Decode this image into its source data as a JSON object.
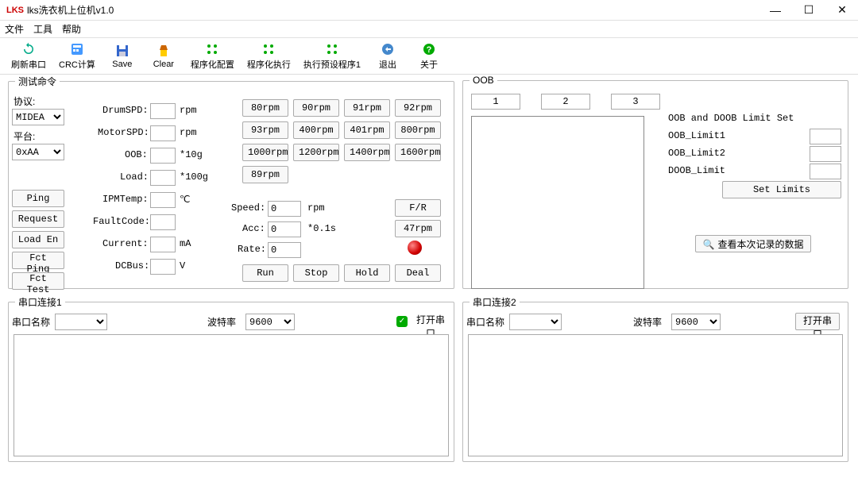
{
  "window": {
    "logo": "LKS",
    "title": "lks洗衣机上位机v1.0"
  },
  "menu": {
    "file": "文件",
    "tools": "工具",
    "help": "帮助"
  },
  "toolbar": {
    "refresh": "刷新串口",
    "crc": "CRC计算",
    "save": "Save",
    "clear": "Clear",
    "cfg": "程序化配置",
    "run": "程序化执行",
    "preset": "执行预设程序1",
    "exit": "退出",
    "about": "关于"
  },
  "groups": {
    "test": "测试命令",
    "oob": "OOB",
    "serial1": "串口连接1",
    "serial2": "串口连接2"
  },
  "test": {
    "protocol_lbl": "协议:",
    "protocol_val": "MIDEA",
    "platform_lbl": "平台:",
    "platform_val": "0xAA",
    "btn_ping": "Ping",
    "btn_request": "Request",
    "btn_loaden": "Load En",
    "btn_fctping": "Fct Ping",
    "btn_fcttest": "Fct Test",
    "drumspd_lbl": "DrumSPD:",
    "drumspd_unit": "rpm",
    "motorspd_lbl": "MotorSPD:",
    "motorspd_unit": "rpm",
    "oob_lbl": "OOB:",
    "oob_unit": "*10g",
    "load_lbl": "Load:",
    "load_unit": "*100g",
    "ipmtemp_lbl": "IPMTemp:",
    "ipmtemp_unit": "℃",
    "fault_lbl": "FaultCode:",
    "current_lbl": "Current:",
    "current_unit": "mA",
    "dcbus_lbl": "DCBus:",
    "dcbus_unit": "V",
    "rpm80": "80rpm",
    "rpm90": "90rpm",
    "rpm91": "91rpm",
    "rpm92": "92rpm",
    "rpm93": "93rpm",
    "rpm400": "400rpm",
    "rpm401": "401rpm",
    "rpm800": "800rpm",
    "rpm1000": "1000rpm",
    "rpm1200": "1200rpm",
    "rpm1400": "1400rpm",
    "rpm1600": "1600rpm",
    "rpm89": "89rpm",
    "speed_lbl": "Speed:",
    "speed_val": "0",
    "speed_unit": "rpm",
    "acc_lbl": "Acc:",
    "acc_val": "0",
    "acc_unit": "*0.1s",
    "rate_lbl": "Rate:",
    "rate_val": "0",
    "btn_fr": "F/R",
    "btn_47rpm": "47rpm",
    "btn_run": "Run",
    "btn_stop": "Stop",
    "btn_hold": "Hold",
    "btn_deal": "Deal"
  },
  "oob": {
    "tab1": "1",
    "tab2": "2",
    "tab3": "3",
    "limitset": "OOB and DOOB Limit Set",
    "lim1": "OOB_Limit1",
    "lim2": "OOB_Limit2",
    "dlim": "DOOB_Limit",
    "btn_set": "Set Limits",
    "btn_view": "查看本次记录的数据"
  },
  "serial": {
    "name_lbl": "串口名称",
    "baud_lbl": "波特率",
    "baud_val": "9600",
    "open": "打开串口"
  }
}
